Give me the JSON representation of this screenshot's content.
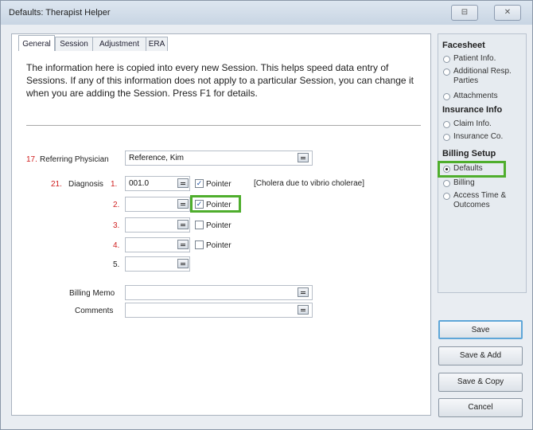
{
  "window": {
    "title": "Defaults: Therapist Helper",
    "restore_glyph": "⊟",
    "close_glyph": "✕"
  },
  "tabs": [
    "General",
    "Session",
    "Adjustment",
    "ERA"
  ],
  "info_text": "The information here is copied into every new Session.   This helps speed data entry of Sessions.  If any of this  information does not apply to a particular Session, you  can change it when you are adding the Session. Press  F1 for details.",
  "referring": {
    "num": "17.",
    "label": "Referring Physician",
    "value": "Reference, Kim"
  },
  "diagnosis": {
    "num": "21.",
    "label": "Diagnosis",
    "rows": [
      {
        "num": "1.",
        "value": "001.0",
        "pointer": true,
        "pointer_label": "Pointer",
        "desc": "[Cholera due to vibrio cholerae]"
      },
      {
        "num": "2.",
        "value": "",
        "pointer": true,
        "pointer_label": "Pointer",
        "desc": ""
      },
      {
        "num": "3.",
        "value": "",
        "pointer": false,
        "pointer_label": "Pointer",
        "desc": ""
      },
      {
        "num": "4.",
        "value": "",
        "pointer": false,
        "pointer_label": "Pointer",
        "desc": ""
      },
      {
        "num": "5.",
        "value": ""
      }
    ]
  },
  "billing_memo": {
    "label": "Billing Memo",
    "value": ""
  },
  "comments": {
    "label": "Comments",
    "value": ""
  },
  "side": {
    "facesheet": "Facesheet",
    "patient_info": "Patient Info.",
    "additional_resp": "Additional Resp. Parties",
    "attachments": "Attachments",
    "insurance_info": "Insurance Info",
    "claim_info": "Claim Info.",
    "insurance_co": "Insurance Co.",
    "billing_setup": "Billing Setup",
    "defaults": "Defaults",
    "billing": "Billing",
    "access_time": "Access Time & Outcomes",
    "selected": "Defaults"
  },
  "buttons": {
    "save": "Save",
    "save_add": "Save & Add",
    "save_copy": "Save & Copy",
    "cancel": "Cancel"
  },
  "colors": {
    "highlight": "#4fae2d",
    "required_number": "#d02020"
  }
}
